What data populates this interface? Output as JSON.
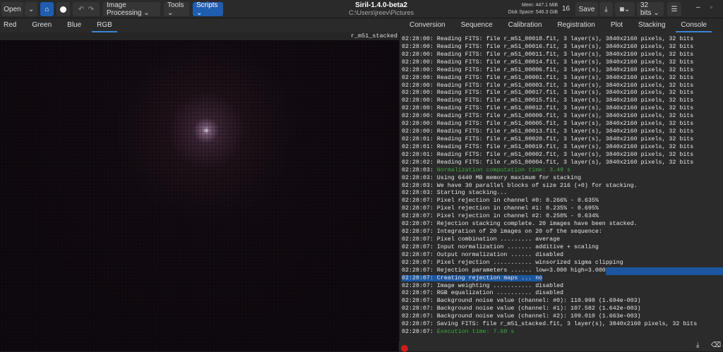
{
  "toolbar": {
    "open": "Open",
    "image_processing": "Image Processing ⌄",
    "tools": "Tools ⌄",
    "scripts": "Scripts ⌄",
    "save": "Save",
    "zoom_value": "16",
    "bits": "32 bits ⌄"
  },
  "window": {
    "title": "Siril-1.4.0-beta2",
    "path": "C:\\Users\\jreev\\Pictures",
    "mem": "Mem: 447.1 MiB",
    "disk": "Disk Space: 546.3 GiB"
  },
  "channel_tabs": [
    "Red",
    "Green",
    "Blue",
    "RGB"
  ],
  "image_name": "r_m51_stacked",
  "panel_tabs": [
    "Conversion",
    "Sequence",
    "Calibration",
    "Registration",
    "Plot",
    "Stacking",
    "Console"
  ],
  "console": [
    {
      "t": "02:28:00: ",
      "m": "Reading FITS: file r_m51_00018.fit, 3 layer(s), 3840x2160 pixels, 32 bits"
    },
    {
      "t": "02:28:00: ",
      "m": "Reading FITS: file r_m51_00016.fit, 3 layer(s), 3840x2160 pixels, 32 bits"
    },
    {
      "t": "02:28:00: ",
      "m": "Reading FITS: file r_m51_00011.fit, 3 layer(s), 3840x2160 pixels, 32 bits"
    },
    {
      "t": "02:28:00: ",
      "m": "Reading FITS: file r_m51_00014.fit, 3 layer(s), 3840x2160 pixels, 32 bits"
    },
    {
      "t": "02:28:00: ",
      "m": "Reading FITS: file r_m51_00006.fit, 3 layer(s), 3840x2160 pixels, 32 bits"
    },
    {
      "t": "02:28:00: ",
      "m": "Reading FITS: file r_m51_00001.fit, 3 layer(s), 3840x2160 pixels, 32 bits"
    },
    {
      "t": "02:28:00: ",
      "m": "Reading FITS: file r_m51_00003.fit, 3 layer(s), 3840x2160 pixels, 32 bits"
    },
    {
      "t": "02:28:00: ",
      "m": "Reading FITS: file r_m51_00017.fit, 3 layer(s), 3840x2160 pixels, 32 bits"
    },
    {
      "t": "02:28:00: ",
      "m": "Reading FITS: file r_m51_00015.fit, 3 layer(s), 3840x2160 pixels, 32 bits"
    },
    {
      "t": "02:28:00: ",
      "m": "Reading FITS: file r_m51_00012.fit, 3 layer(s), 3840x2160 pixels, 32 bits"
    },
    {
      "t": "02:28:00: ",
      "m": "Reading FITS: file r_m51_00009.fit, 3 layer(s), 3840x2160 pixels, 32 bits"
    },
    {
      "t": "02:28:00: ",
      "m": "Reading FITS: file r_m51_00005.fit, 3 layer(s), 3840x2160 pixels, 32 bits"
    },
    {
      "t": "02:28:00: ",
      "m": "Reading FITS: file r_m51_00013.fit, 3 layer(s), 3840x2160 pixels, 32 bits"
    },
    {
      "t": "02:28:01: ",
      "m": "Reading FITS: file r_m51_00020.fit, 3 layer(s), 3840x2160 pixels, 32 bits"
    },
    {
      "t": "02:28:01: ",
      "m": "Reading FITS: file r_m51_00019.fit, 3 layer(s), 3840x2160 pixels, 32 bits"
    },
    {
      "t": "02:28:01: ",
      "m": "Reading FITS: file r_m51_00002.fit, 3 layer(s), 3840x2160 pixels, 32 bits"
    },
    {
      "t": "02:28:02: ",
      "m": "Reading FITS: file r_m51_00004.fit, 3 layer(s), 3840x2160 pixels, 32 bits"
    },
    {
      "t": "02:28:03: ",
      "m": "Normalization computation time: 3.49 s",
      "c": "green"
    },
    {
      "t": "02:28:03: ",
      "m": "Using 6440 MB memory maximum for stacking"
    },
    {
      "t": "02:28:03: ",
      "m": "We have 30 parallel blocks of size 216 (+0) for stacking."
    },
    {
      "t": "02:28:03: ",
      "m": "Starting stacking..."
    },
    {
      "t": "02:28:07: ",
      "m": "Pixel rejection in channel #0: 0.266% - 0.635%"
    },
    {
      "t": "02:28:07: ",
      "m": "Pixel rejection in channel #1: 0.235% - 0.695%"
    },
    {
      "t": "02:28:07: ",
      "m": "Pixel rejection in channel #2: 0.250% - 0.634%"
    },
    {
      "t": "02:28:07: ",
      "m": "Rejection stacking complete. 20 images have been stacked."
    },
    {
      "t": "02:28:07: ",
      "m": "Integration of 20 images on 20 of the sequence:"
    },
    {
      "t": "02:28:07: ",
      "m": "Pixel combination ......... average"
    },
    {
      "t": "02:28:07: ",
      "m": "Input normalization ....... additive + scaling"
    },
    {
      "t": "02:28:07: ",
      "m": "Output normalization ...... disabled"
    },
    {
      "t": "02:28:07: ",
      "m": "Pixel rejection ........... winsorized sigma clipping"
    },
    {
      "t": "02:28:07: ",
      "m": "Rejection parameters ...... low=3.000 high=3.000",
      "c": "selend"
    },
    {
      "t": "02:28:07: ",
      "m": "Creating rejection maps ... no",
      "c": "sel"
    },
    {
      "t": "02:28:07: ",
      "m": "Image weighting ........... disabled"
    },
    {
      "t": "02:28:07: ",
      "m": "RGB equalization .......... disabled"
    },
    {
      "t": "02:28:07: ",
      "m": "Background noise value (channel: #0): 110.998 (1.694e-003)"
    },
    {
      "t": "02:28:07: ",
      "m": "Background noise value (channel: #1): 107.582 (1.642e-003)"
    },
    {
      "t": "02:28:07: ",
      "m": "Background noise value (channel: #2): 109.010 (1.663e-003)"
    },
    {
      "t": "02:28:07: ",
      "m": "Saving FITS: file r_m51_stacked.fit, 3 layer(s), 3840x2160 pixels, 32 bits"
    },
    {
      "t": "02:28:07: ",
      "m": "Execution time: 7.60 s",
      "c": "green"
    }
  ],
  "colors": {
    "accent": "#1f5db0",
    "green": "#3fa83f",
    "stop": "#d11a1a"
  }
}
